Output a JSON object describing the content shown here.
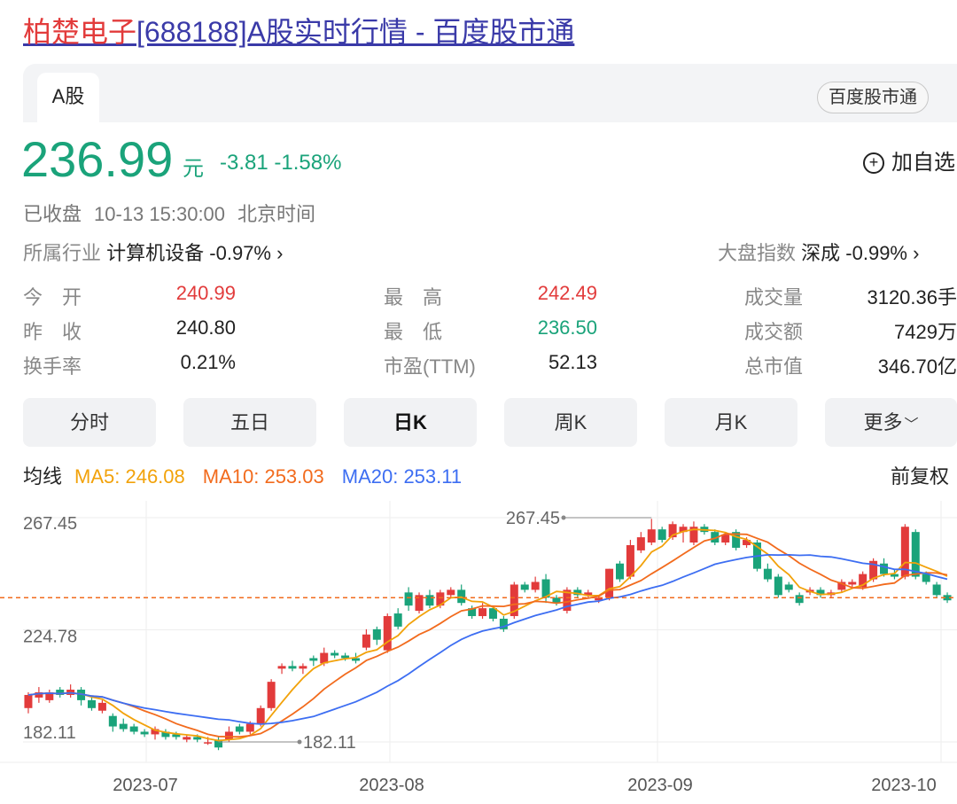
{
  "page": {
    "title_name": "柏楚电子",
    "title_rest": "[688188]A股实时行情 - 百度股市通"
  },
  "tabs": {
    "a_share": "A股",
    "baidu_stock": "百度股市通"
  },
  "quote": {
    "price": "236.99",
    "unit": "元",
    "change": "-3.81",
    "change_pct": "-1.58%",
    "add_watchlist": "加自选",
    "status": "已收盘",
    "datetime": "10-13 15:30:00",
    "tz": "北京时间",
    "industry_label": "所属行业",
    "industry_name": "计算机设备",
    "industry_change": "-0.97%",
    "index_label": "大盘指数",
    "index_name": "深成",
    "index_change": "-0.99%"
  },
  "stats": {
    "open_label": "今　开",
    "open": "240.99",
    "prev_close_label": "昨　收",
    "prev_close": "240.80",
    "turnover_label": "换手率",
    "turnover": "0.21%",
    "high_label": "最　高",
    "high": "242.49",
    "low_label": "最　低",
    "low": "236.50",
    "pe_label": "市盈(TTM)",
    "pe": "52.13",
    "volume_label": "成交量",
    "volume": "3120.36手",
    "amount_label": "成交额",
    "amount": "7429万",
    "mcap_label": "总市值",
    "mcap": "346.70亿"
  },
  "periods": [
    "分时",
    "五日",
    "日K",
    "周K",
    "月K",
    "更多"
  ],
  "active_period": "日K",
  "ma": {
    "label": "均线",
    "ma5": "MA5: 246.08",
    "ma10": "MA10: 253.03",
    "ma20": "MA20: 253.11",
    "adjust": "前复权"
  },
  "colors": {
    "up": "#e23b3b",
    "down": "#1aa37a",
    "ma5": "#f2a20a",
    "ma10": "#f26b1d",
    "ma20": "#3d6ef2"
  },
  "chart_data": {
    "type": "candlestick",
    "y_ticks": [
      "267.45",
      "224.78",
      "182.11"
    ],
    "x_ticks": [
      "2023-07",
      "2023-08",
      "2023-09",
      "2023-10"
    ],
    "high_label": "267.45",
    "low_label": "182.11",
    "last_close": 236.99,
    "ylim": [
      182.11,
      267.45
    ],
    "candles": [
      [
        195,
        200,
        193,
        201
      ],
      [
        199,
        201,
        197,
        203
      ],
      [
        198,
        201,
        197,
        202
      ],
      [
        202,
        200,
        199,
        203
      ],
      [
        200,
        202,
        199,
        204
      ],
      [
        202,
        198,
        196,
        203
      ],
      [
        198,
        195,
        194,
        199
      ],
      [
        194,
        197,
        193,
        198
      ],
      [
        192,
        188,
        186,
        193
      ],
      [
        189,
        187,
        186,
        191
      ],
      [
        188,
        186,
        185,
        189
      ],
      [
        186,
        185,
        184,
        187
      ],
      [
        185,
        187,
        183,
        188
      ],
      [
        186,
        184,
        183,
        187
      ],
      [
        185,
        184,
        183,
        186
      ],
      [
        183,
        184,
        182,
        185
      ],
      [
        184,
        183,
        182,
        185
      ],
      [
        182,
        182,
        181,
        184
      ],
      [
        183,
        180,
        179,
        184
      ],
      [
        183,
        186,
        182,
        188
      ],
      [
        188,
        186,
        185,
        189
      ],
      [
        186,
        189,
        185,
        190
      ],
      [
        189,
        195,
        188,
        196
      ],
      [
        195,
        205,
        194,
        206
      ],
      [
        210,
        211,
        208,
        212
      ],
      [
        211,
        210,
        209,
        213
      ],
      [
        210,
        211,
        208,
        212
      ],
      [
        214,
        213,
        211,
        215
      ],
      [
        212,
        216,
        211,
        218
      ],
      [
        216,
        215,
        214,
        217
      ],
      [
        215,
        214,
        213,
        216
      ],
      [
        214,
        213,
        212,
        216
      ],
      [
        218,
        223,
        217,
        225
      ],
      [
        225,
        221,
        219,
        226
      ],
      [
        217,
        230,
        216,
        231
      ],
      [
        231,
        226,
        225,
        233
      ],
      [
        239,
        234,
        232,
        241
      ],
      [
        232,
        238,
        231,
        239
      ],
      [
        238,
        234,
        233,
        240
      ],
      [
        234,
        239,
        233,
        240
      ],
      [
        238,
        240,
        237,
        241
      ],
      [
        240,
        235,
        234,
        242
      ],
      [
        233,
        230,
        229,
        234
      ],
      [
        230,
        233,
        229,
        235
      ],
      [
        233,
        229,
        228,
        234
      ],
      [
        229,
        225,
        224,
        230
      ],
      [
        230,
        242,
        229,
        243
      ],
      [
        242,
        240,
        239,
        243
      ],
      [
        240,
        243,
        239,
        245
      ],
      [
        244,
        237,
        235,
        246
      ],
      [
        237,
        235,
        234,
        238
      ],
      [
        232,
        240,
        231,
        241
      ],
      [
        240,
        238,
        237,
        241
      ],
      [
        238,
        239,
        237,
        240
      ],
      [
        236,
        237,
        235,
        238
      ],
      [
        237,
        248,
        236,
        248
      ],
      [
        250,
        244,
        243,
        251
      ],
      [
        245,
        257,
        244,
        259
      ],
      [
        255,
        260,
        254,
        262
      ],
      [
        258,
        263,
        257,
        267
      ],
      [
        263,
        259,
        258,
        264
      ],
      [
        260,
        265,
        259,
        266
      ],
      [
        262,
        264,
        258,
        265
      ],
      [
        258,
        264,
        257,
        266
      ],
      [
        264,
        262,
        261,
        265
      ],
      [
        262,
        258,
        257,
        263
      ],
      [
        258,
        261,
        257,
        262
      ],
      [
        262,
        256,
        255,
        263
      ],
      [
        257,
        259,
        256,
        260
      ],
      [
        258,
        248,
        247,
        259
      ],
      [
        248,
        244,
        243,
        250
      ],
      [
        245,
        238,
        237,
        246
      ],
      [
        242,
        240,
        239,
        243
      ],
      [
        238,
        235,
        234,
        239
      ],
      [
        239,
        240,
        238,
        241
      ],
      [
        240,
        238,
        237,
        241
      ],
      [
        238,
        239,
        237,
        240
      ],
      [
        240,
        243,
        239,
        244
      ],
      [
        242,
        243,
        241,
        244
      ],
      [
        241,
        246,
        240,
        247
      ],
      [
        244,
        251,
        243,
        252
      ],
      [
        250,
        246,
        245,
        252
      ],
      [
        246,
        245,
        244,
        248
      ],
      [
        245,
        264,
        244,
        265
      ],
      [
        262,
        245,
        244,
        263
      ],
      [
        246,
        243,
        242,
        247
      ],
      [
        242,
        238,
        237,
        243
      ],
      [
        238,
        236,
        235,
        239
      ]
    ]
  }
}
